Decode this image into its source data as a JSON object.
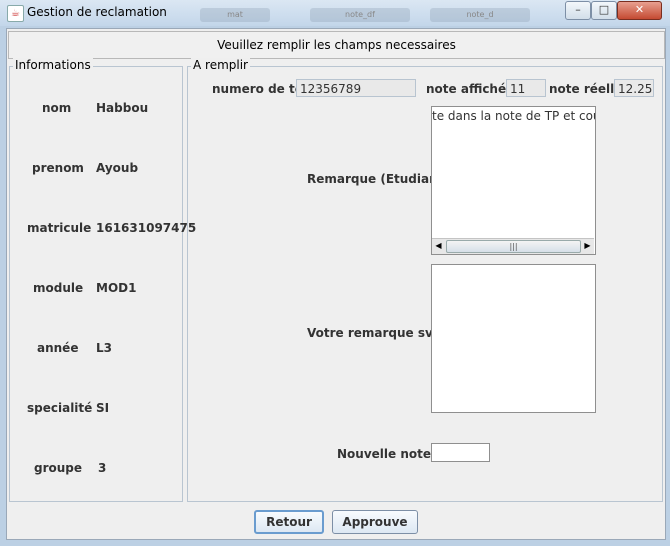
{
  "window": {
    "title": "Gestion de reclamation",
    "bg_tabs": [
      "mat",
      "note_df",
      "note_d"
    ],
    "buttons": {
      "minimize": "–",
      "maximize": "□",
      "close": "✕"
    }
  },
  "header": {
    "text": "Veuillez remplir les champs necessaires"
  },
  "info": {
    "legend": "Informations",
    "rows": [
      {
        "label": "nom",
        "value": "Habbou"
      },
      {
        "label": "prenom",
        "value": "Ayoub"
      },
      {
        "label": "matricule",
        "value": "161631097475"
      },
      {
        "label": "module",
        "value": "MOD1"
      },
      {
        "label": "année",
        "value": "L3"
      },
      {
        "label": "specialité",
        "value": "SI"
      },
      {
        "label": "groupe",
        "value": "3"
      }
    ]
  },
  "form": {
    "legend": "A remplir",
    "tel_label": "numero de tel",
    "tel_value": "12356789",
    "note_affichee_label": "note affichée",
    "note_affichee_value": "11",
    "note_reelle_label": "note réelle",
    "note_reelle_value": "12.25",
    "remarque_etudiant_label": "Remarque (Etudiant)",
    "remarque_etudiant_text": "te dans la note de TP et cours",
    "votre_remarque_label": "Votre remarque svp",
    "votre_remarque_text": "",
    "nouvelle_note_label": "Nouvelle note",
    "nouvelle_note_value": ""
  },
  "footer": {
    "retour": "Retour",
    "approuve": "Approuve"
  }
}
